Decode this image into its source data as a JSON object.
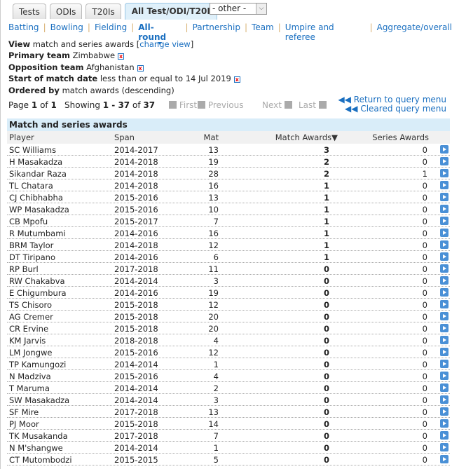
{
  "tabs": [
    "Tests",
    "ODIs",
    "T20Is",
    "All Test/ODI/T20I"
  ],
  "other_select": "- other -",
  "nav": [
    "Batting",
    "Bowling",
    "Fielding",
    "All-round",
    "Partnership",
    "Team",
    "Umpire and referee",
    "Aggregate/overall"
  ],
  "filters": {
    "view_label": "View",
    "view_value": "match and series awards",
    "change_view": "change view",
    "primary_label": "Primary team",
    "primary_value": "Zimbabwe",
    "opposition_label": "Opposition team",
    "opposition_value": "Afghanistan",
    "date_label": "Start of match date",
    "date_value": "less than or equal to 14 Jul 2019",
    "order_label": "Ordered by",
    "order_value": "match awards (descending)"
  },
  "pager": {
    "page": "Page",
    "cur": "1",
    "of": "of",
    "total": "1",
    "showing": "Showing",
    "range": "1 - 37",
    "of2": "of",
    "count": "37",
    "first": "First",
    "previous": "Previous",
    "next": "Next",
    "last": "Last"
  },
  "query": {
    "return": "Return to query menu",
    "cleared": "Cleared query menu"
  },
  "table": {
    "caption": "Match and series awards",
    "headers": [
      "Player",
      "Span",
      "Mat",
      "Match Awards",
      "Series Awards"
    ],
    "rows": [
      [
        "SC Williams",
        "2014-2017",
        "13",
        "3",
        "0"
      ],
      [
        "H Masakadza",
        "2014-2018",
        "19",
        "2",
        "0"
      ],
      [
        "Sikandar Raza",
        "2014-2018",
        "28",
        "2",
        "1"
      ],
      [
        "TL Chatara",
        "2014-2018",
        "16",
        "1",
        "0"
      ],
      [
        "CJ Chibhabha",
        "2015-2016",
        "13",
        "1",
        "0"
      ],
      [
        "WP Masakadza",
        "2015-2016",
        "10",
        "1",
        "0"
      ],
      [
        "CB Mpofu",
        "2015-2017",
        "7",
        "1",
        "0"
      ],
      [
        "R Mutumbami",
        "2014-2016",
        "16",
        "1",
        "0"
      ],
      [
        "BRM Taylor",
        "2014-2018",
        "12",
        "1",
        "0"
      ],
      [
        "DT Tiripano",
        "2014-2016",
        "6",
        "1",
        "0"
      ],
      [
        "RP Burl",
        "2017-2018",
        "11",
        "0",
        "0"
      ],
      [
        "RW Chakabva",
        "2014-2014",
        "3",
        "0",
        "0"
      ],
      [
        "E Chigumbura",
        "2014-2016",
        "19",
        "0",
        "0"
      ],
      [
        "TS Chisoro",
        "2015-2018",
        "12",
        "0",
        "0"
      ],
      [
        "AG Cremer",
        "2015-2018",
        "20",
        "0",
        "0"
      ],
      [
        "CR Ervine",
        "2015-2018",
        "20",
        "0",
        "0"
      ],
      [
        "KM Jarvis",
        "2018-2018",
        "4",
        "0",
        "0"
      ],
      [
        "LM Jongwe",
        "2015-2016",
        "12",
        "0",
        "0"
      ],
      [
        "TP Kamungozi",
        "2014-2014",
        "1",
        "0",
        "0"
      ],
      [
        "N Madziva",
        "2015-2016",
        "4",
        "0",
        "0"
      ],
      [
        "T Maruma",
        "2014-2014",
        "2",
        "0",
        "0"
      ],
      [
        "SW Masakadza",
        "2014-2014",
        "3",
        "0",
        "0"
      ],
      [
        "SF Mire",
        "2017-2018",
        "13",
        "0",
        "0"
      ],
      [
        "PJ Moor",
        "2015-2018",
        "14",
        "0",
        "0"
      ],
      [
        "TK Musakanda",
        "2017-2018",
        "7",
        "0",
        "0"
      ],
      [
        "N M'shangwe",
        "2014-2014",
        "1",
        "0",
        "0"
      ],
      [
        "CT Mutombodzi",
        "2015-2015",
        "5",
        "0",
        "0"
      ]
    ]
  }
}
